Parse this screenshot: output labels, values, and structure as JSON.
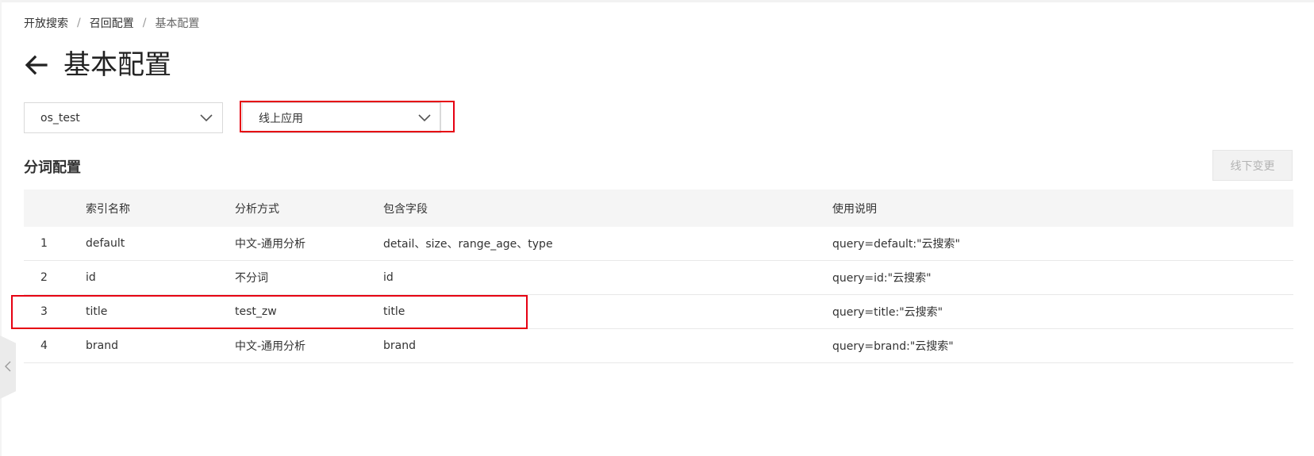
{
  "breadcrumb": {
    "items": [
      "开放搜索",
      "召回配置"
    ],
    "current": "基本配置",
    "separator": "/"
  },
  "header": {
    "title": "基本配置",
    "back_icon": "arrow-left-icon"
  },
  "selectors": {
    "app": {
      "value": "os_test"
    },
    "environment": {
      "value": "线上应用"
    }
  },
  "section": {
    "title": "分词配置",
    "offline_change_label": "线下变更"
  },
  "table": {
    "columns": [
      "",
      "索引名称",
      "分析方式",
      "包含字段",
      "使用说明"
    ],
    "rows": [
      {
        "num": "1",
        "name": "default",
        "analyzer": "中文-通用分析",
        "fields": "detail、size、range_age、type",
        "usage": "query=default:\"云搜索\""
      },
      {
        "num": "2",
        "name": "id",
        "analyzer": "不分词",
        "fields": "id",
        "usage": "query=id:\"云搜索\""
      },
      {
        "num": "3",
        "name": "title",
        "analyzer": "test_zw",
        "fields": "title",
        "usage": "query=title:\"云搜索\""
      },
      {
        "num": "4",
        "name": "brand",
        "analyzer": "中文-通用分析",
        "fields": "brand",
        "usage": "query=brand:\"云搜索\""
      }
    ]
  },
  "colors": {
    "highlight": "#e60012",
    "header_bg": "#f5f5f5",
    "disabled_bg": "#f2f2f2"
  }
}
